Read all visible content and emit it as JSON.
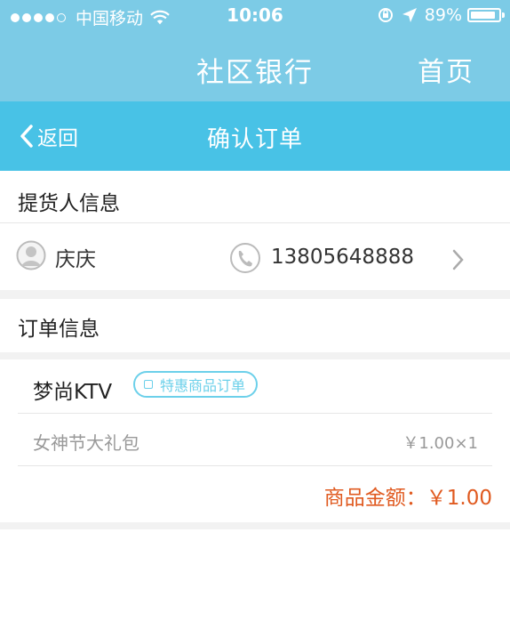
{
  "status_bar": {
    "carrier": "中国移动",
    "time": "10:06",
    "battery": "89%",
    "signal_bars": 4,
    "signal_total": 5,
    "battery_level": 0.89
  },
  "app_bar": {
    "title": "社区银行",
    "home_label": "首页"
  },
  "nav_bar": {
    "back_label": "返回",
    "title": "确认订单"
  },
  "pickup": {
    "section_title": "提货人信息",
    "name": "庆庆",
    "phone": "13805648888"
  },
  "order": {
    "section_title": "订单信息",
    "shop_name": "梦尚KTV",
    "badge": "特惠商品订单",
    "items": [
      {
        "name": "女神节大礼包",
        "price_qty": "￥1.00×1"
      }
    ],
    "total_label": "商品金额：￥1.00"
  },
  "colors": {
    "app_bar": "#7ccbe6",
    "nav_bar": "#48c2e6",
    "accent": "#6cd0ea",
    "total": "#e05a20"
  }
}
